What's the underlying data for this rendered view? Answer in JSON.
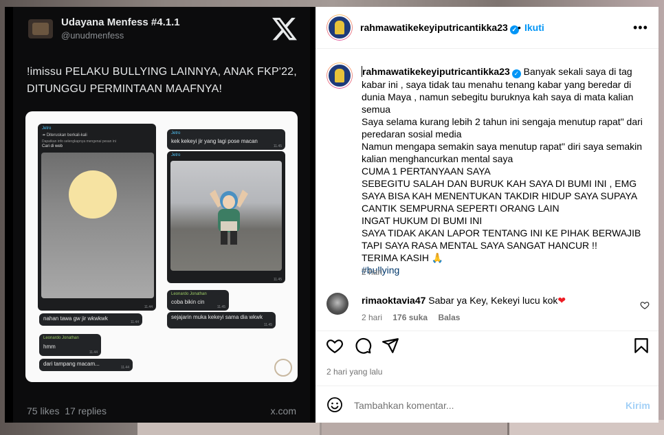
{
  "tweet": {
    "name": "Udayana Menfess #4.1.1",
    "handle": "@unudmenfess",
    "text": "!imissu PELAKU BULLYING LAINNYA, ANAK FKP'22, DITUNGGU PERMINTAAN MAAFNYA!",
    "likes": "75 likes",
    "replies": "17 replies",
    "site": "x.com",
    "chats": {
      "c1_name": "Jetro",
      "c1_forward": "Diteruskan berkali-kali",
      "c1_info": "Dapatkan info selengkapnya mengenai pesan ini",
      "c1_web": "Cari di web",
      "c1_time": "11.44",
      "c2_text": "nahan tawa gw jir wkwkwk",
      "c2_time": "11.44",
      "c3_name": "Leonardo Jonathan",
      "c3_text": "hmm",
      "c3_time": "11.44",
      "c4_text": "dari tampang macam...",
      "c4_time": "11.44",
      "r1_name": "Jetro",
      "r1_text": "kek kekeyi jir yang lagi pose macan",
      "r1_time": "11.45",
      "r2_name": "Jetro",
      "r2_time": "11.45",
      "r3_name": "Leonardo Jonathan",
      "r3_text": "coba bikin cin",
      "r3_time": "11.45",
      "r4_text": "sejajarin muka kekeyi sama dia wkwk",
      "r4_time": "11.45"
    }
  },
  "post": {
    "username": "rahmawatikekeyiputricantikka23",
    "follow": "Ikuti",
    "separator": "•",
    "caption_lines": "Banyak sekali saya di tag kabar ini , saya tidak tau menahu tenang kabar yang beredar di dunia Maya , namun sebegitu buruknya kah saya di mata kalian semua\nSaya selama kurang lebih 2 tahun ini sengaja menutup rapat\" dari peredaran sosial media\nNamun mengapa semakin saya menutup rapat\" diri saya semakin kalian menghancurkan mental saya\nCUMA 1 PERTANYAAN SAYA\nSEBEGITU SALAH DAN BURUK KAH SAYA DI BUMI INI , EMG SAYA BISA KAH MENENTUKAN TAKDIR HIDUP SAYA SUPAYA CANTIK SEMPURNA SEPERTI ORANG LAIN\nINGAT HUKUM DI BUMI INI\nSAYA TIDAK AKAN LAPOR TENTANG INI KE PIHAK BERWAJIB\nTAPI SAYA RASA MENTAL SAYA SANGAT HANCUR !!\nTERIMA KASIH 🙏",
    "hashtag": "#bullying",
    "caption_time": "2 hari",
    "comment": {
      "user": "rimaoktavia47",
      "text": "Sabar ya Key, Kekeyi lucu kok",
      "heart": "❤",
      "time": "2 hari",
      "likes": "176 suka",
      "reply": "Balas"
    },
    "posted": "2 hari yang lalu",
    "comment_placeholder": "Tambahkan komentar...",
    "send": "Kirim"
  }
}
